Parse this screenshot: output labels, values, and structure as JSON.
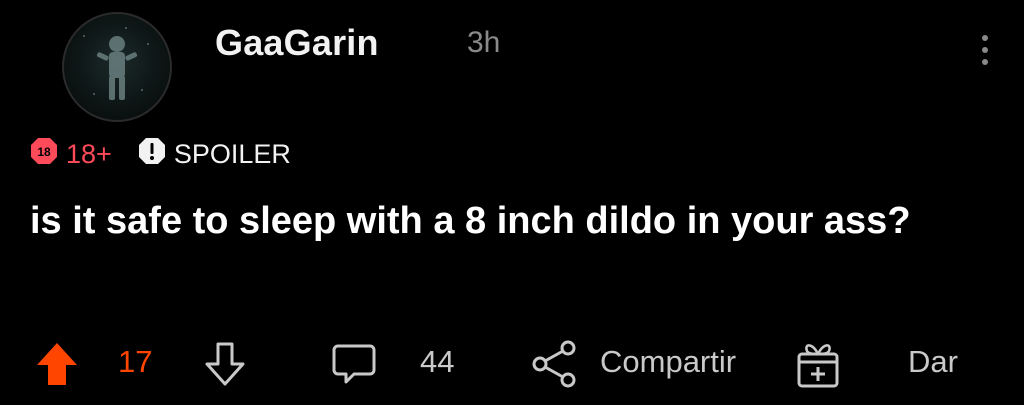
{
  "post": {
    "author": "GaaGarin",
    "time": "3h",
    "tags": {
      "nsfw_badge": "18",
      "nsfw_label": "18+",
      "spoiler_label": "SPOILER"
    },
    "title": "is it safe to sleep with a 8 inch dildo in your ass?",
    "votes": "17",
    "comments": "44",
    "share_label": "Compartir",
    "award_label": "Dar"
  },
  "icons": {
    "more": "more-vertical-icon",
    "upvote": "upvote-arrow-icon",
    "downvote": "downvote-arrow-icon",
    "comment": "comment-bubble-icon",
    "share": "share-icon",
    "gift": "gift-icon"
  },
  "colors": {
    "background": "#000000",
    "upvote_active": "#ff4500",
    "nsfw": "#ff4a5a",
    "muted": "#8a8a8a"
  }
}
